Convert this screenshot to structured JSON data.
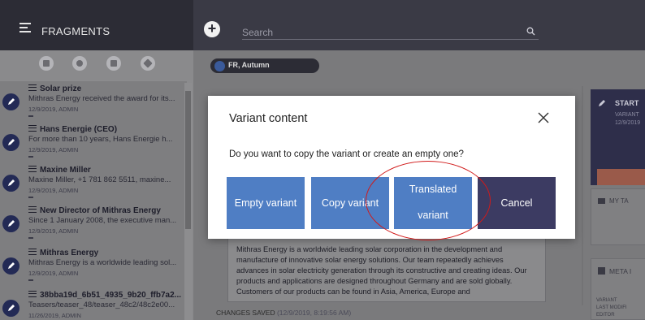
{
  "header": {
    "app_title": "FRAGMENTS",
    "search_placeholder": "Search"
  },
  "fragments": [
    {
      "title": "Solar prize",
      "excerpt": "Mithras Energy received the award for its...",
      "meta": "12/9/2019, ADMIN"
    },
    {
      "title": "Hans Energie (CEO)",
      "excerpt": "For more than 10 years, Hans Energie h...",
      "meta": "12/9/2019, ADMIN"
    },
    {
      "title": "Maxine Miller",
      "excerpt": "Maxine Miller, +1 781 862 5511, maxine...",
      "meta": "12/9/2019, ADMIN"
    },
    {
      "title": "New Director of Mithras Energy",
      "excerpt": "Since 1 January 2008, the executive man...",
      "meta": "12/9/2019, ADMIN"
    },
    {
      "title": "Mithras Energy",
      "excerpt": "Mithras Energy is a worldwide leading sol...",
      "meta": "12/9/2019, ADMIN"
    },
    {
      "title": "38bba19d_6b51_4935_9b20_ffb7a2...",
      "excerpt": "Teasers/teaser_48/teaser_48c2/48c2e00...",
      "meta": "11/26/2019, ADMIN"
    }
  ],
  "variant": {
    "label": "FR, Autumn"
  },
  "document": {
    "text": "Mithras Energy is a worldwide leading solar corporation in the development and manufacture of innovative solar energy solutions. Our team repeatedly achieves advances in solar electricity generation through its constructive and creating ideas. Our products and applications are designed throughout Germany and are sold globally. Customers of our products can be found in Asia, America, Europe and"
  },
  "status": {
    "label": "CHANGES SAVED",
    "timestamp": "(12/9/2019, 8:19:56 AM)"
  },
  "right_panel": {
    "start_title": "START",
    "start_sub": "VARIANT",
    "start_date": "12/9/2019",
    "tasks_title": "MY TA",
    "meta_title": "META I",
    "meta_lines": [
      "VARIANT",
      "LAST MODIFI",
      "EDITOR"
    ]
  },
  "modal": {
    "title": "Variant content",
    "question": "Do you want to copy the variant or create an empty one?",
    "buttons": {
      "empty": "Empty variant",
      "copy": "Copy variant",
      "translated_line1": "Translated",
      "translated_line2": "variant",
      "cancel": "Cancel"
    }
  },
  "colors": {
    "primary_button": "#4f7ec4",
    "cancel_button": "#3c3b62",
    "highlight_ellipse": "#d11a1a",
    "topbar": "#2c2c35"
  }
}
